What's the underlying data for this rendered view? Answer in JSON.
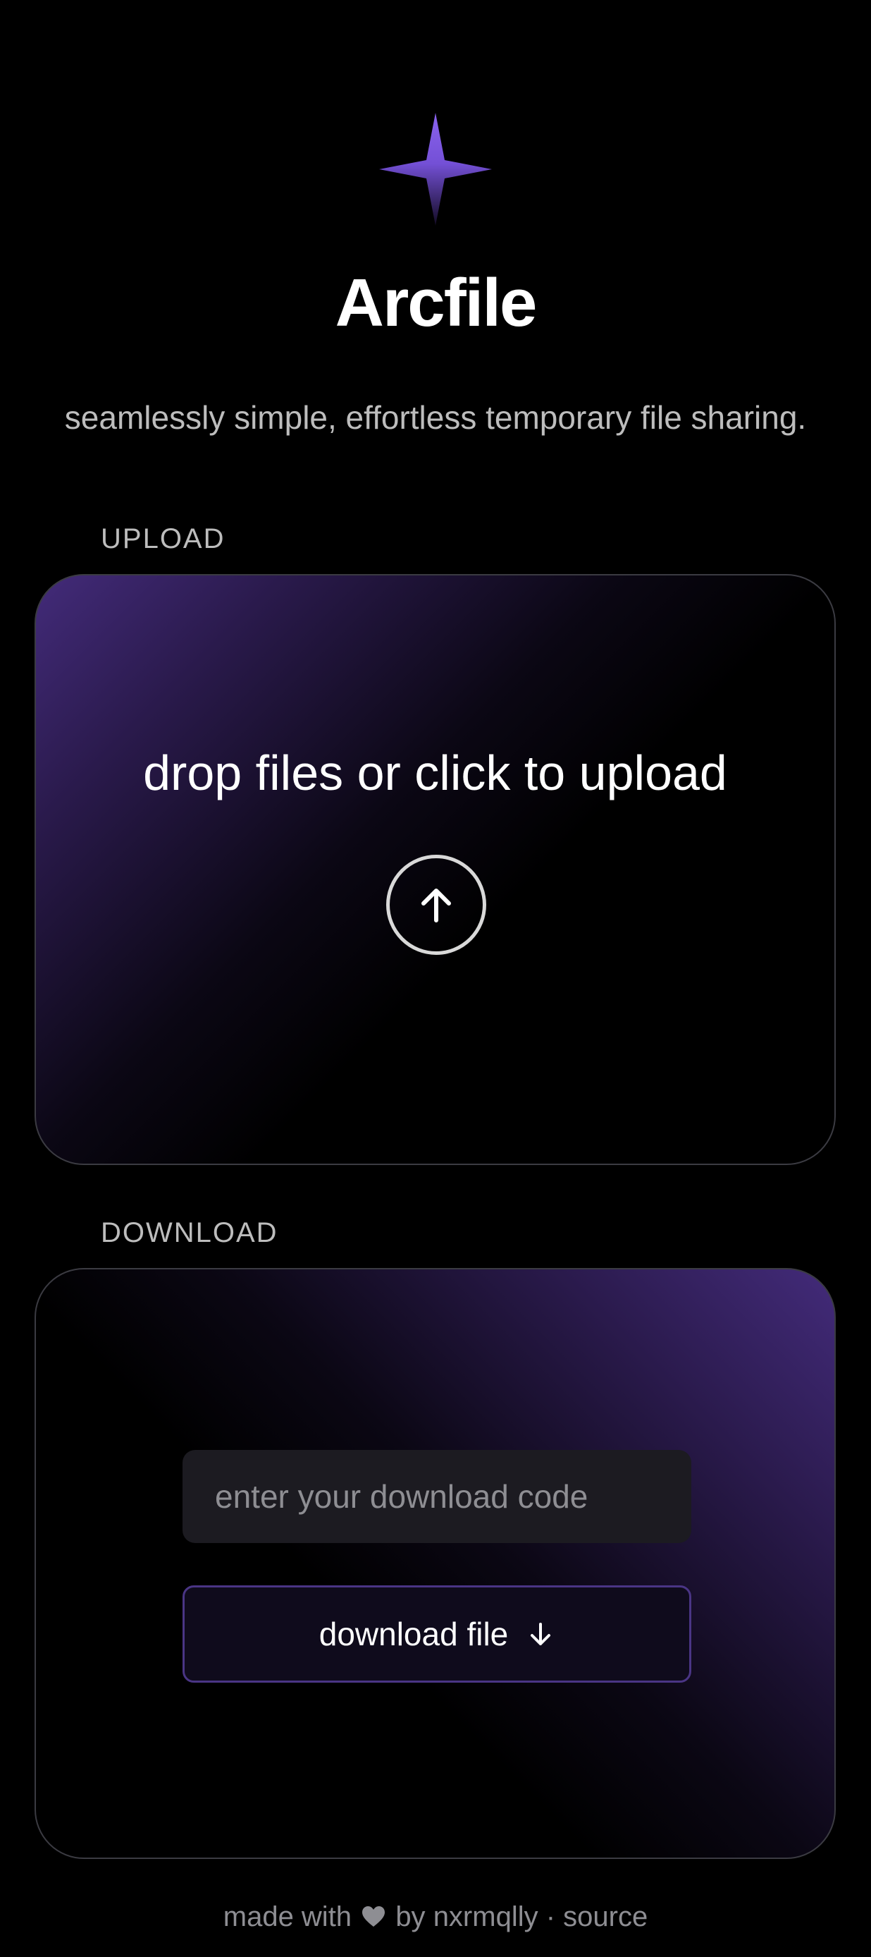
{
  "app": {
    "logo_icon": "four-point-star-icon",
    "title": "Arcfile",
    "subtitle": "seamlessly simple, effortless temporary file sharing."
  },
  "upload": {
    "section_label": "UPLOAD",
    "dropzone_text": "drop files or click to upload",
    "upload_icon": "arrow-up-circle-icon"
  },
  "download": {
    "section_label": "DOWNLOAD",
    "code_input": {
      "value": "",
      "placeholder": "enter your download code"
    },
    "button_label": "download file",
    "button_icon": "arrow-down-icon"
  },
  "footer": {
    "prefix": "made with",
    "heart_icon": "heart-icon",
    "by_text": "by",
    "author": "nxrmqlly",
    "separator": "·",
    "source_link": "source"
  },
  "colors": {
    "background": "#000000",
    "accent_purple": "#7a55e0",
    "gradient_purple": "#432b7a",
    "text_primary": "#ffffff",
    "text_muted": "#bdbdbd",
    "footer_text": "#8e8e93"
  }
}
